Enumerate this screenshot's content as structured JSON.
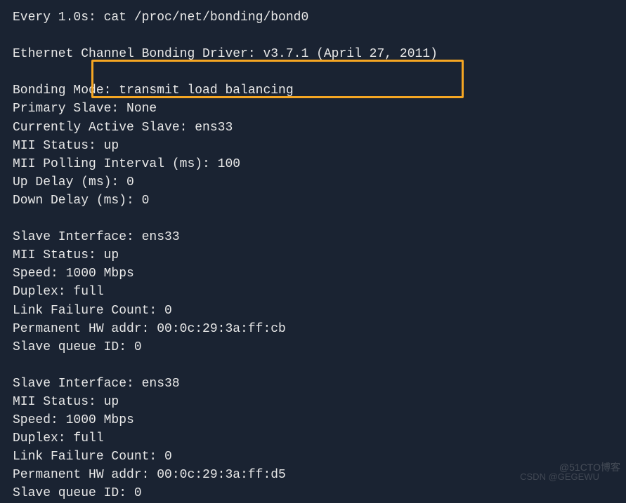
{
  "header": {
    "watch_line": "Every 1.0s: cat /proc/net/bonding/bond0"
  },
  "driver": {
    "line": "Ethernet Channel Bonding Driver: v3.7.1 (April 27, 2011)"
  },
  "bonding": {
    "mode": "Bonding Mode: transmit load balancing",
    "primary_slave": "Primary Slave: None",
    "active_slave": "Currently Active Slave: ens33",
    "mii_status": "MII Status: up",
    "mii_polling": "MII Polling Interval (ms): 100",
    "up_delay": "Up Delay (ms): 0",
    "down_delay": "Down Delay (ms): 0"
  },
  "slave1": {
    "interface": "Slave Interface: ens33",
    "mii_status": "MII Status: up",
    "speed": "Speed: 1000 Mbps",
    "duplex": "Duplex: full",
    "link_failure": "Link Failure Count: 0",
    "hw_addr": "Permanent HW addr: 00:0c:29:3a:ff:cb",
    "queue_id": "Slave queue ID: 0"
  },
  "slave2": {
    "interface": "Slave Interface: ens38",
    "mii_status": "MII Status: up",
    "speed": "Speed: 1000 Mbps",
    "duplex": "Duplex: full",
    "link_failure": "Link Failure Count: 0",
    "hw_addr": "Permanent HW addr: 00:0c:29:3a:ff:d5",
    "queue_id": "Slave queue ID: 0"
  },
  "watermarks": {
    "right": "@51CTO博客",
    "center": "CSDN @GEGEWU"
  }
}
